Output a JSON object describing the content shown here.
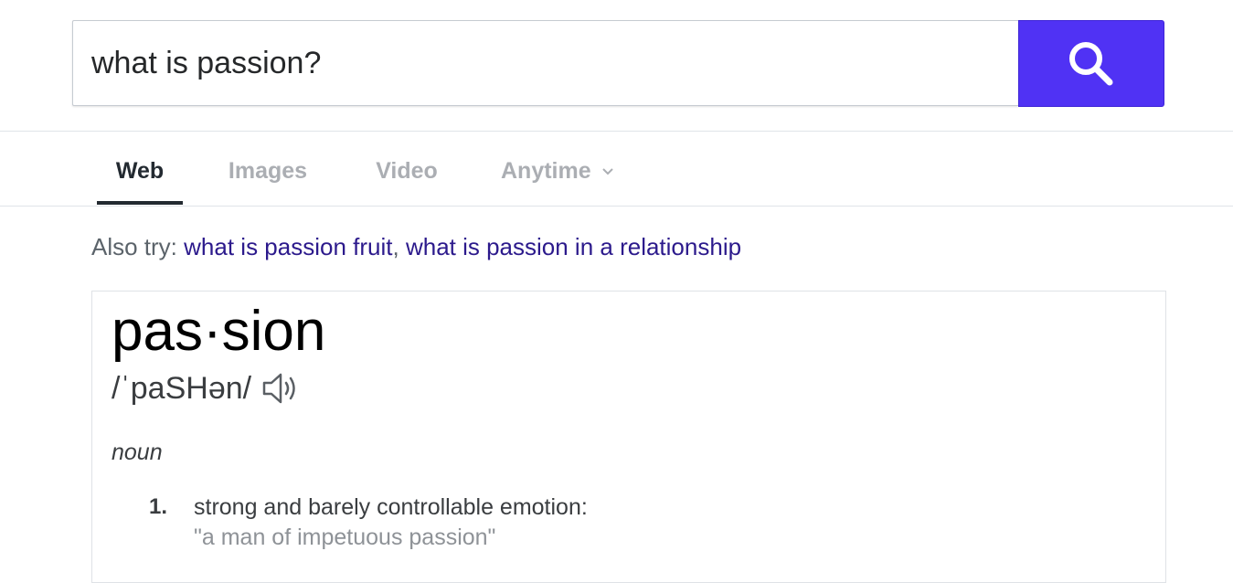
{
  "search": {
    "query": "what is passion?",
    "button_icon": "search-icon"
  },
  "tabs": [
    {
      "label": "Web",
      "active": true
    },
    {
      "label": "Images",
      "active": false
    },
    {
      "label": "Video",
      "active": false
    },
    {
      "label": "Anytime",
      "active": false,
      "dropdown": true
    }
  ],
  "also_try": {
    "prefix": "Also try:",
    "suggestions": [
      "what is passion fruit",
      "what is passion in a relationship"
    ],
    "separator": ","
  },
  "definition": {
    "word": "pas·sion",
    "pronunciation": "/ˈpaSHən/",
    "audio_icon": "speaker-icon",
    "part_of_speech": "noun",
    "senses": [
      {
        "number": "1.",
        "text": "strong and barely controllable emotion:",
        "example": "\"a man of impetuous passion\""
      }
    ]
  },
  "colors": {
    "accent": "#5032f4",
    "link": "#2c1a8c",
    "active_tab": "#232a31",
    "inactive_tab": "#abaeb3"
  }
}
